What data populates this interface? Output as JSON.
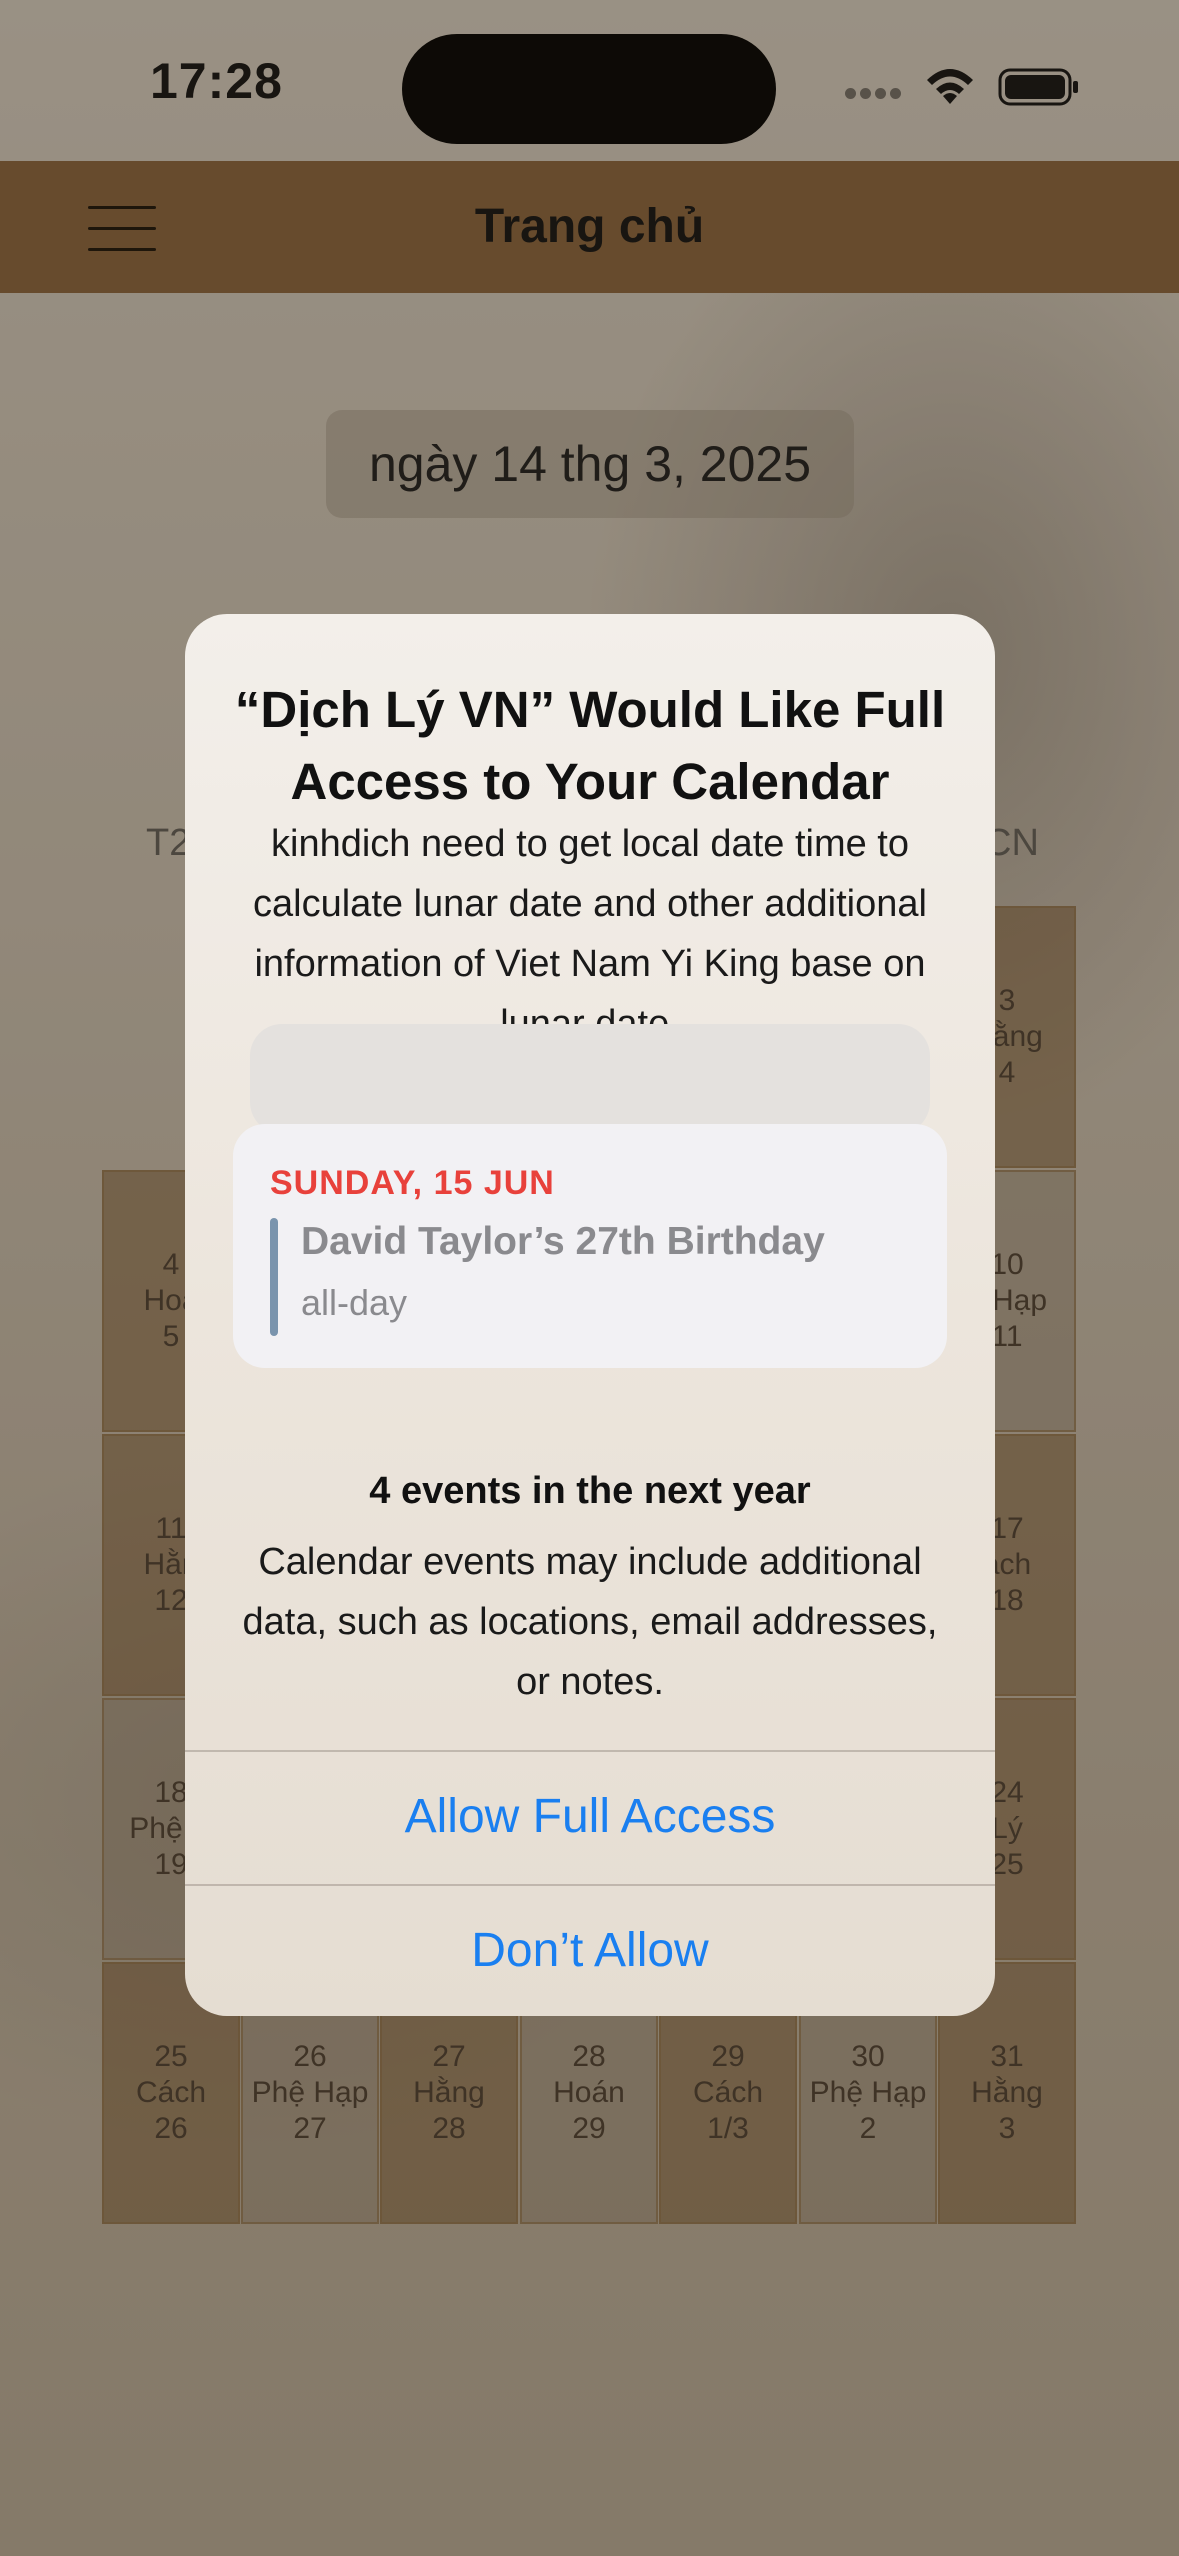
{
  "status_bar": {
    "time": "17:28"
  },
  "nav": {
    "title": "Trang chủ"
  },
  "date_pill": {
    "text": "ngày 14 thg 3, 2025"
  },
  "calendar": {
    "weekday_left": "T2",
    "weekday_right": "CN",
    "cells": [
      {
        "day": "3",
        "label": "Hằng",
        "lunar": "4"
      },
      {
        "day": "4",
        "label": "Hoá",
        "lunar": "5"
      },
      {
        "day": "10",
        "label": "ệ Hạp",
        "lunar": "11"
      },
      {
        "day": "11",
        "label": "Hằn",
        "lunar": "12"
      },
      {
        "day": "17",
        "label": "ách",
        "lunar": "18"
      },
      {
        "day": "18",
        "label": "Phệ H",
        "lunar": "19"
      },
      {
        "day": "24",
        "label": "Lý",
        "lunar": "25"
      },
      {
        "day": "25",
        "label": "Cách",
        "lunar": "26"
      },
      {
        "day": "26",
        "label": "Phệ Hạp",
        "lunar": "27"
      },
      {
        "day": "27",
        "label": "Hằng",
        "lunar": "28"
      },
      {
        "day": "28",
        "label": "Hoán",
        "lunar": "29"
      },
      {
        "day": "29",
        "label": "Cách",
        "lunar": "1/3"
      },
      {
        "day": "30",
        "label": "Phệ Hạp",
        "lunar": "2"
      },
      {
        "day": "31",
        "label": "Hằng",
        "lunar": "3"
      }
    ]
  },
  "alert": {
    "title": "“Dịch Lý VN” Would Like Full Access to Your Calendar",
    "message": "kinhdich need to get local date time to calculate lunar date and other additional information of Viet Nam Yi King base on lunar date.",
    "event_preview": {
      "date": "SUNDAY, 15 JUN",
      "name": "David Taylor’s 27th Birthday",
      "time": "all-day"
    },
    "events_count": "4 events in the next year",
    "events_note": "Calendar events may include additional data, such as locations, email addresses, or notes.",
    "allow_button": "Allow Full Access",
    "deny_button": "Don’t Allow"
  },
  "colors": {
    "nav_bg": "#85603a",
    "alert_button": "#1a7ff0",
    "event_date": "#e8413b"
  }
}
